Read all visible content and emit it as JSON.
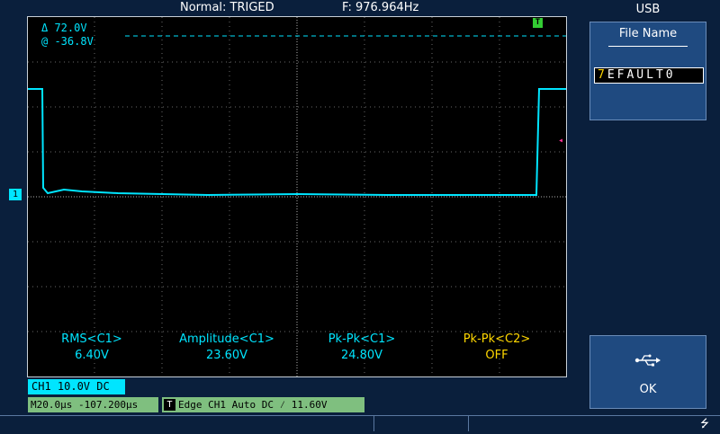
{
  "status": {
    "mode": "Normal: TRIGED",
    "frequency": "F: 976.964Hz"
  },
  "cursor": {
    "delta": "Δ  72.0V",
    "at": "@  -36.8V"
  },
  "markers": {
    "trigger": "T",
    "channel1": "1",
    "trigger_level": "◂"
  },
  "measurements": [
    {
      "label": "RMS<C1>",
      "value": "6.40V",
      "color": "#00e5ff"
    },
    {
      "label": "Amplitude<C1>",
      "value": "23.60V",
      "color": "#00e5ff"
    },
    {
      "label": "Pk-Pk<C1>",
      "value": "24.80V",
      "color": "#00e5ff"
    },
    {
      "label": "Pk-Pk<C2>",
      "value": "OFF",
      "color": "#ffd700"
    }
  ],
  "channel_info": "CH1  10.0V  DC",
  "timebase": "M20.0μs -107.200μs",
  "trigger_info": {
    "icon": "T",
    "text": "Edge  CH1  Auto  DC ⁄  11.60V"
  },
  "right_panel": {
    "title": "USB",
    "file_name_label": "File Name",
    "file_name_cursor": "7",
    "file_name_value": "EFAULT0",
    "ok_icon": "usb-icon",
    "ok_label": "OK"
  },
  "colors": {
    "ch1": "#00e5ff",
    "ch2": "#ffd700",
    "trigger": "#33cc33",
    "trigger_level": "#ff3399",
    "panel": "#1f4a80",
    "background": "#0a1f3c"
  }
}
